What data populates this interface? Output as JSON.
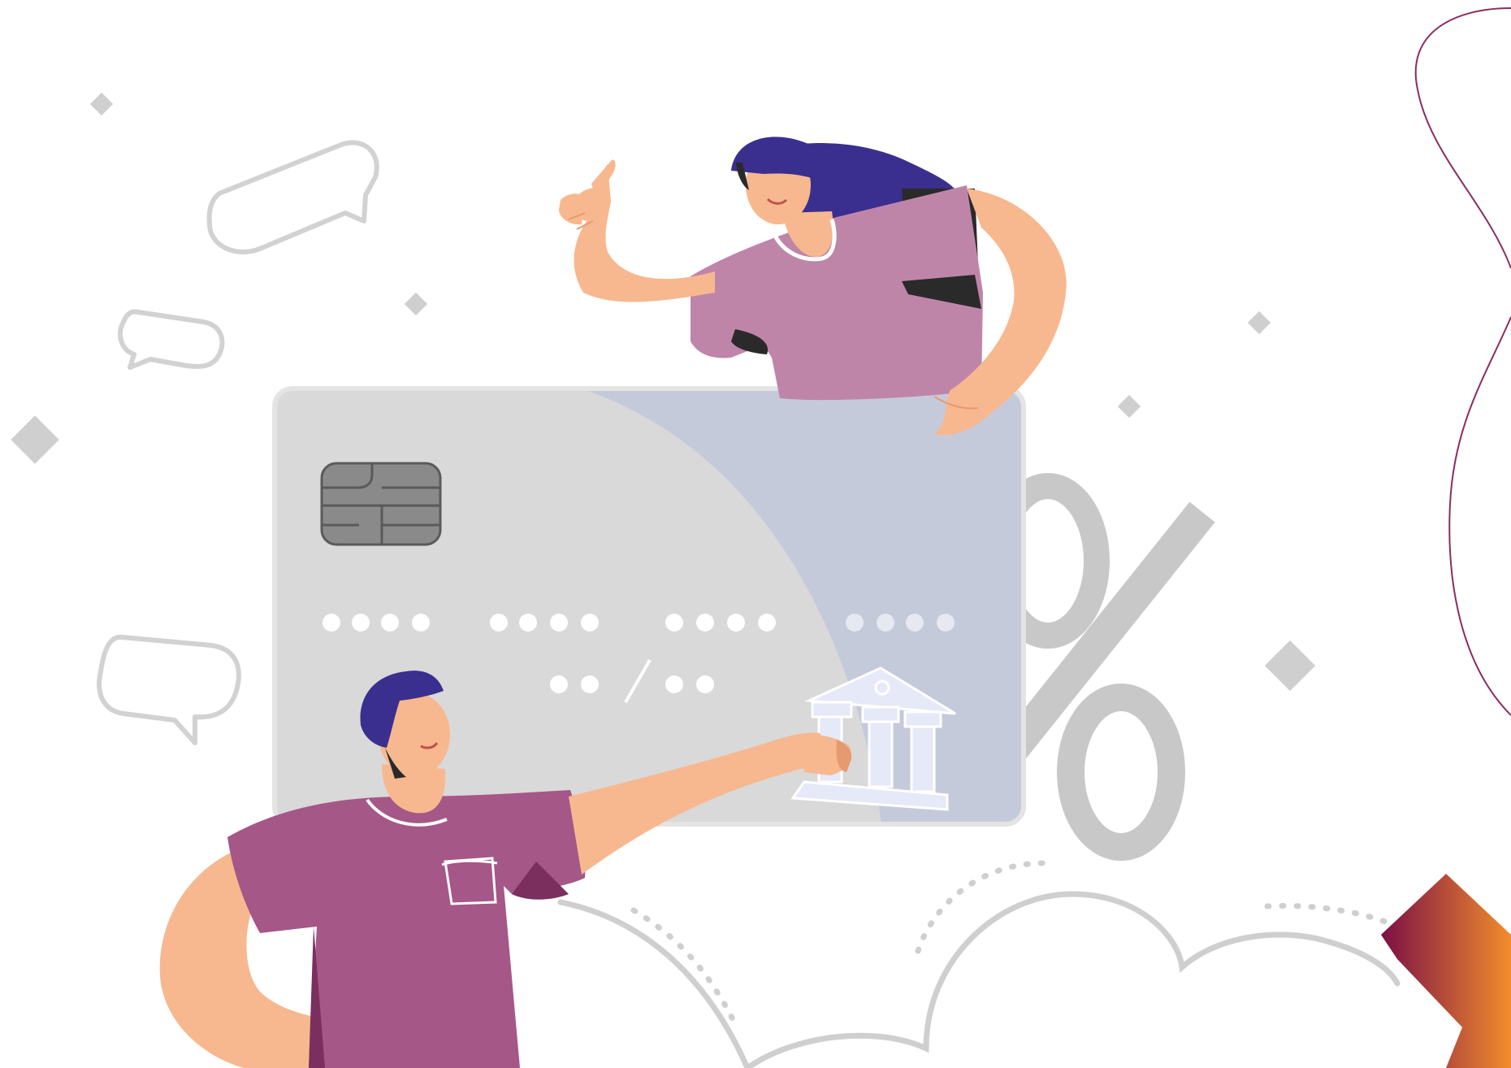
{
  "scene": {
    "description_visible_text": [],
    "card": {
      "number_groups": [
        "••••",
        "••••",
        "••••",
        "••••"
      ],
      "expiry": "•• / ••"
    },
    "colors": {
      "background": "#ffffff",
      "card_left": "#d9d9d9",
      "card_right": "#c5cadb",
      "chip": "#8a8a8a",
      "woman_shirt": "#bf85a9",
      "man_shirt": "#a55787",
      "hair": "#3a2f8f",
      "skin": "#f7b88f",
      "outline_gray": "#cfcfcf",
      "percent_gray": "#c8c8c8",
      "accent_dark": "#7a0f45",
      "accent_orange": "#f28c2c",
      "curve_line": "#8a2d5f"
    },
    "icons": [
      "speech-bubble-icon",
      "bank-icon",
      "percent-icon",
      "chevron-right-icon",
      "credit-card-chip-icon"
    ]
  }
}
